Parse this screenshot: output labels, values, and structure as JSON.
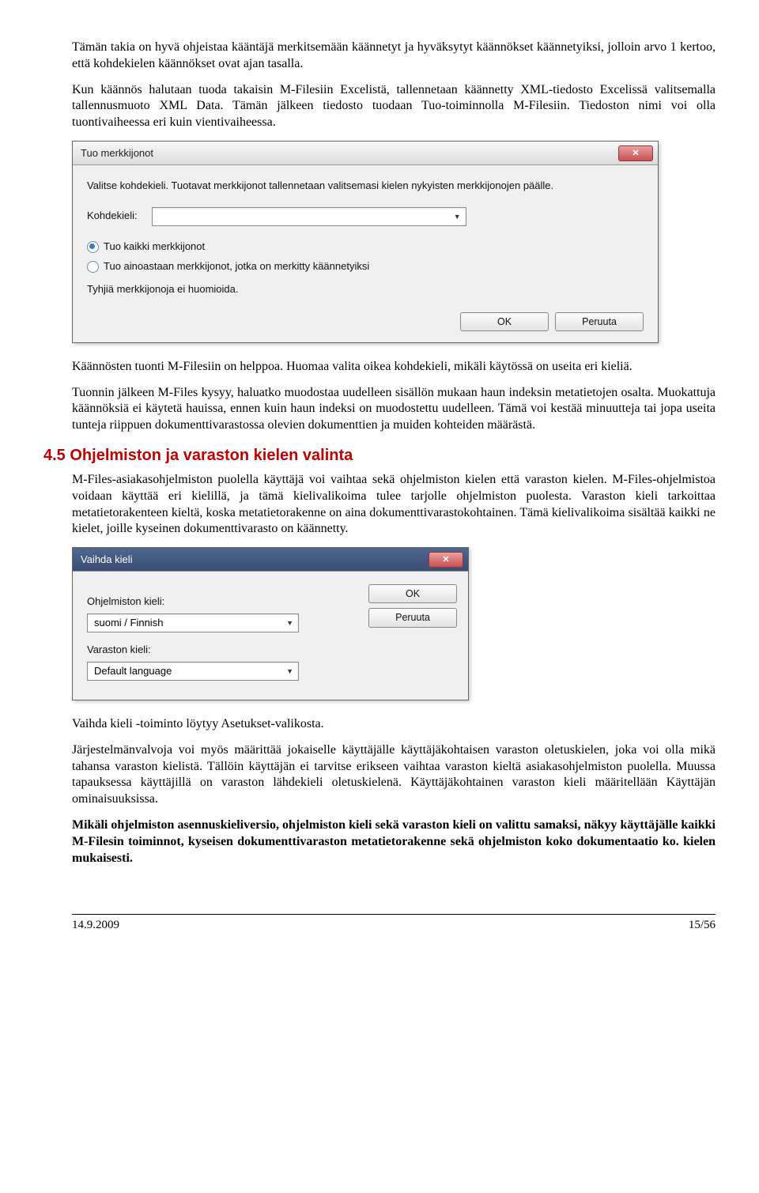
{
  "para1": "Tämän takia on hyvä ohjeistaa kääntäjä merkitsemään käännetyt ja hyväksytyt käännökset käännetyiksi, jolloin arvo 1 kertoo, että kohdekielen käännökset ovat ajan tasalla.",
  "para2": "Kun käännös halutaan tuoda takaisin M-Filesiin Excelistä, tallennetaan käännetty XML-tiedosto Excelissä valitsemalla tallennusmuoto XML Data. Tämän jälkeen tiedosto tuodaan Tuo-toiminnolla M-Filesiin. Tiedoston nimi voi olla tuontivaiheessa eri kuin vientivaiheessa.",
  "dialog1": {
    "title": "Tuo merkkijonot",
    "instruction": "Valitse kohdekieli. Tuotavat merkkijonot tallennetaan valitsemasi kielen nykyisten merkkijonojen päälle.",
    "targetLabel": "Kohdekieli:",
    "radio1": "Tuo kaikki merkkijonot",
    "radio2": "Tuo ainoastaan merkkijonot, jotka on merkitty käännetyiksi",
    "note": "Tyhjiä merkkijonoja ei huomioida.",
    "ok": "OK",
    "cancel": "Peruuta"
  },
  "para3": "Käännösten tuonti M-Filesiin on helppoa. Huomaa valita oikea kohdekieli, mikäli käytössä on useita eri kieliä.",
  "para4": "Tuonnin jälkeen M-Files kysyy, haluatko muodostaa uudelleen sisällön mukaan haun indeksin metatietojen osalta. Muokattuja käännöksiä ei käytetä hauissa, ennen kuin haun indeksi on muodostettu uudelleen. Tämä voi kestää minuutteja tai jopa useita tunteja riippuen dokumenttivarastossa olevien dokumenttien ja muiden kohteiden määrästä.",
  "heading": "4.5 Ohjelmiston ja varaston kielen valinta",
  "para5": "M-Files-asiakasohjelmiston puolella käyttäjä voi vaihtaa sekä ohjelmiston kielen että varaston kielen. M-Files-ohjelmistoa voidaan käyttää eri kielillä, ja tämä kielivalikoima tulee tarjolle ohjelmiston puolesta. Varaston kieli tarkoittaa metatietorakenteen kieltä, koska metatietorakenne on aina dokumenttivarastokohtainen. Tämä kielivalikoima sisältää kaikki ne kielet, joille kyseinen dokumenttivarasto on käännetty.",
  "dialog2": {
    "title": "Vaihda kieli",
    "label1": "Ohjelmiston kieli:",
    "value1": "suomi / Finnish",
    "label2": "Varaston kieli:",
    "value2": "Default language",
    "ok": "OK",
    "cancel": "Peruuta"
  },
  "para6": "Vaihda kieli -toiminto löytyy Asetukset-valikosta.",
  "para7": "Järjestelmänvalvoja voi myös määrittää jokaiselle käyttäjälle käyttäjäkohtaisen varaston oletuskielen, joka voi olla mikä tahansa varaston kielistä. Tällöin käyttäjän ei tarvitse erikseen vaihtaa varaston kieltä asiakasohjelmiston puolella. Muussa tapauksessa käyttäjillä on varaston lähdekieli oletuskielenä. Käyttäjäkohtainen varaston kieli määritellään Käyttäjän ominaisuuksissa.",
  "para8": "Mikäli ohjelmiston asennuskieliversio, ohjelmiston kieli sekä varaston kieli on valittu samaksi, näkyy käyttäjälle kaikki M-Filesin toiminnot, kyseisen dokumenttivaraston metatietorakenne sekä ohjelmiston koko dokumentaatio ko. kielen mukaisesti.",
  "footer": {
    "date": "14.9.2009",
    "page": "15/56"
  }
}
